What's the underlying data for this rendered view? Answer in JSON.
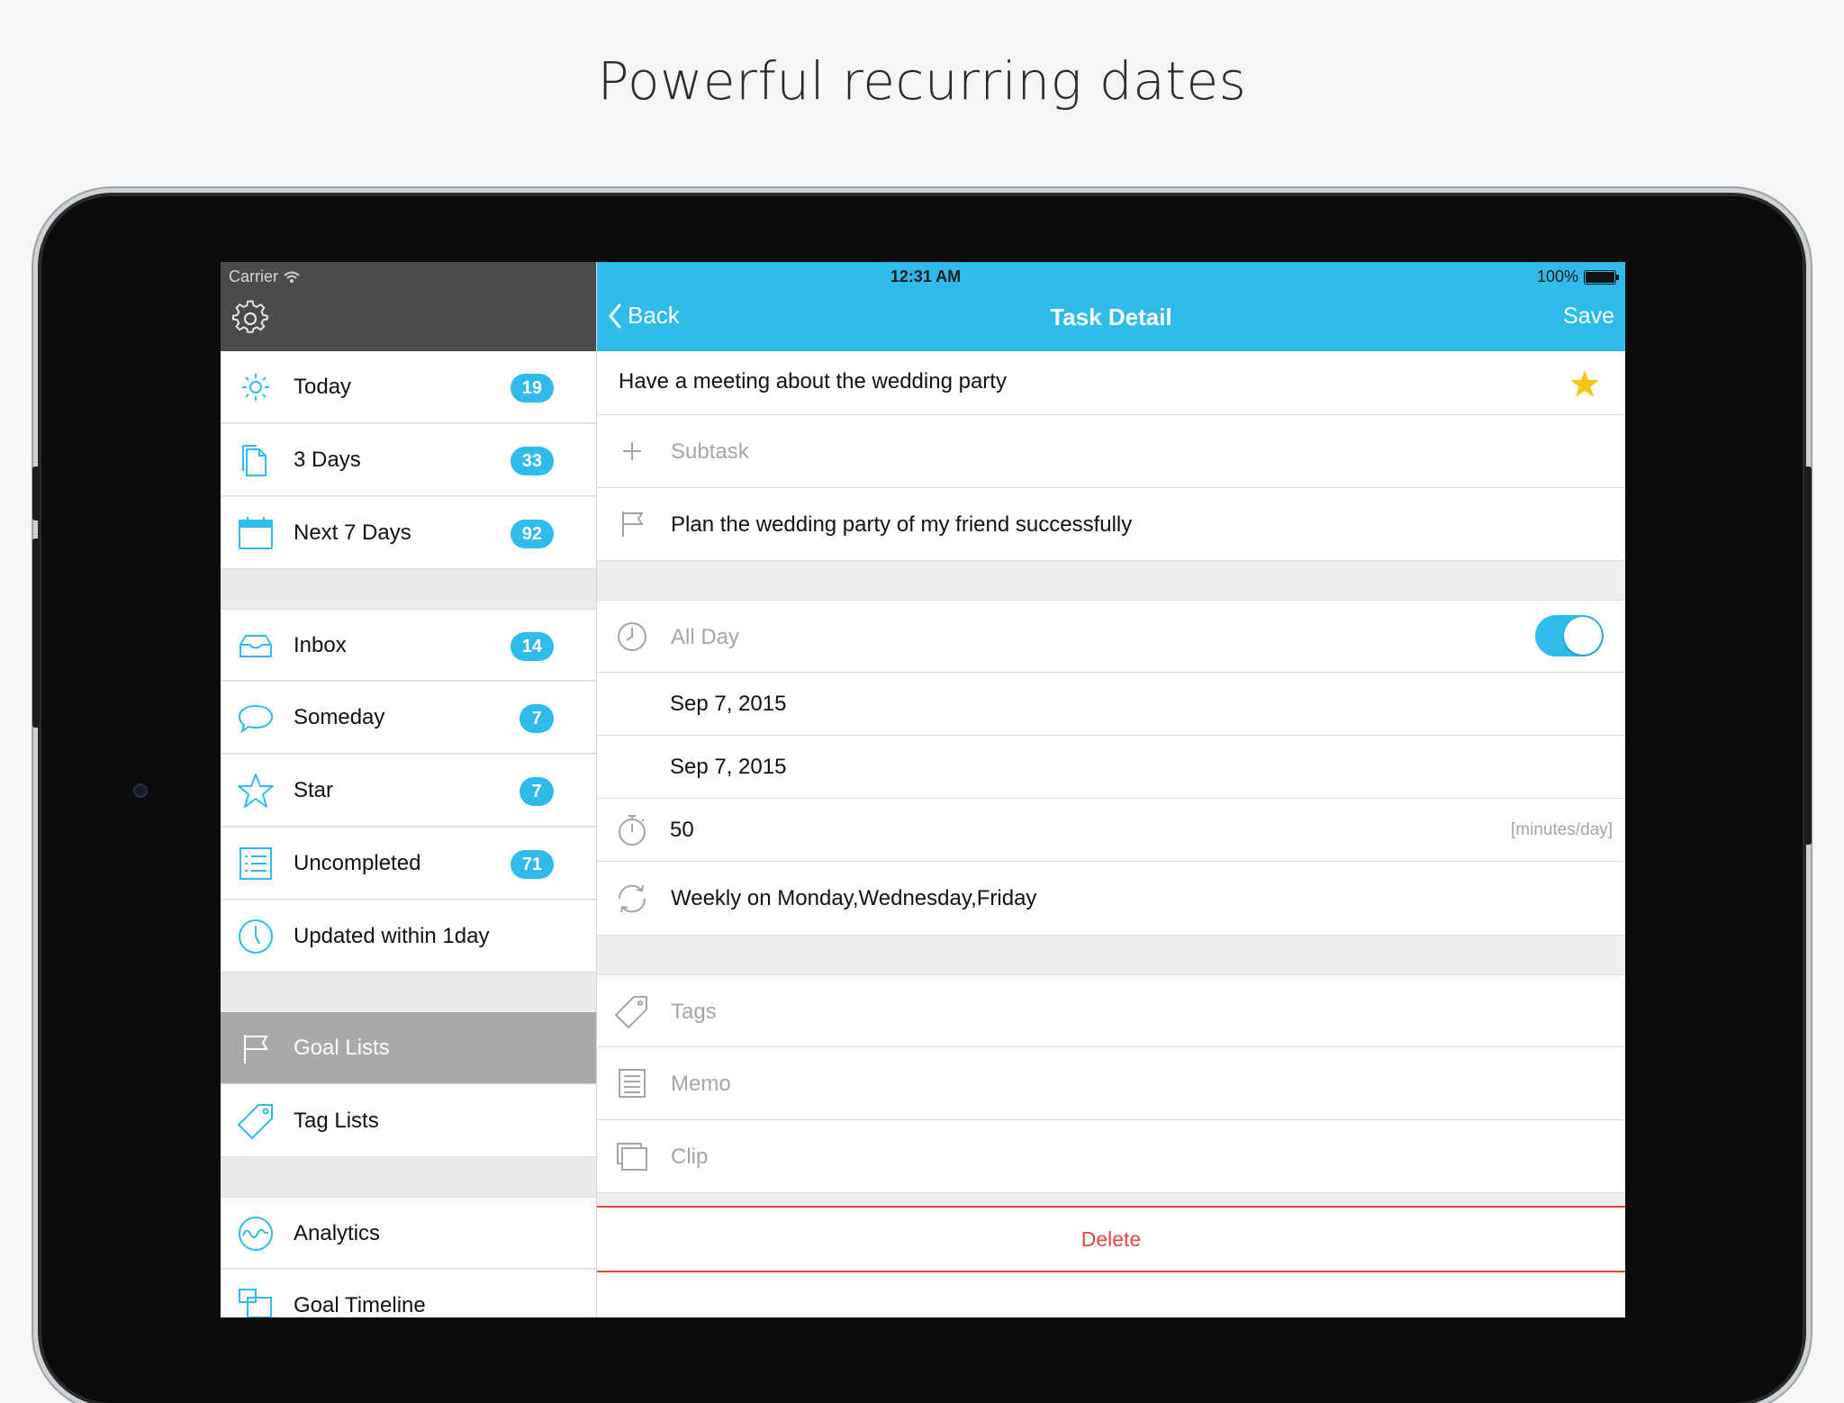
{
  "headline": "Powerful recurring dates",
  "status_bar": {
    "carrier": "Carrier",
    "time": "12:31 AM",
    "battery": "100%"
  },
  "sidebar": {
    "items": [
      {
        "label": "Today",
        "badge": "19",
        "icon": "sun-icon"
      },
      {
        "label": "3 Days",
        "badge": "33",
        "icon": "document-icon"
      },
      {
        "label": "Next 7 Days",
        "badge": "92",
        "icon": "calendar-icon"
      },
      {
        "label": "Inbox",
        "badge": "14",
        "icon": "inbox-tray-icon"
      },
      {
        "label": "Someday",
        "badge": "7",
        "icon": "speech-bubble-icon"
      },
      {
        "label": "Star",
        "badge": "7",
        "icon": "star-outline-icon"
      },
      {
        "label": "Uncompleted",
        "badge": "71",
        "icon": "list-icon"
      },
      {
        "label": "Updated within 1day",
        "badge": "",
        "icon": "clock-icon"
      },
      {
        "label": "Goal Lists",
        "badge": "",
        "icon": "flag-icon",
        "active": true
      },
      {
        "label": "Tag Lists",
        "badge": "",
        "icon": "tag-icon"
      },
      {
        "label": "Analytics",
        "badge": "",
        "icon": "analytics-wave-icon"
      },
      {
        "label": "Goal Timeline",
        "badge": "",
        "icon": "timeline-icon"
      }
    ]
  },
  "nav": {
    "back": "Back",
    "title": "Task Detail",
    "save": "Save"
  },
  "task": {
    "title": "Have a meeting about the wedding party",
    "starred": true,
    "subtask_placeholder": "Subtask",
    "goal": "Plan the wedding party of my friend successfully",
    "all_day_label": "All Day",
    "all_day_on": true,
    "start_date": "Sep 7, 2015",
    "end_date": "Sep 7, 2015",
    "duration": "50",
    "duration_unit": "[minutes/day]",
    "repeat": "Weekly on Monday,Wednesday,Friday",
    "tags_placeholder": "Tags",
    "memo_placeholder": "Memo",
    "clip_placeholder": "Clip",
    "delete_label": "Delete"
  },
  "colors": {
    "accent": "#2fbbeb",
    "star": "#f5c518",
    "danger": "#e8453c",
    "sidebar_header": "#4b4b4b",
    "active_item": "#a9a9a9"
  }
}
